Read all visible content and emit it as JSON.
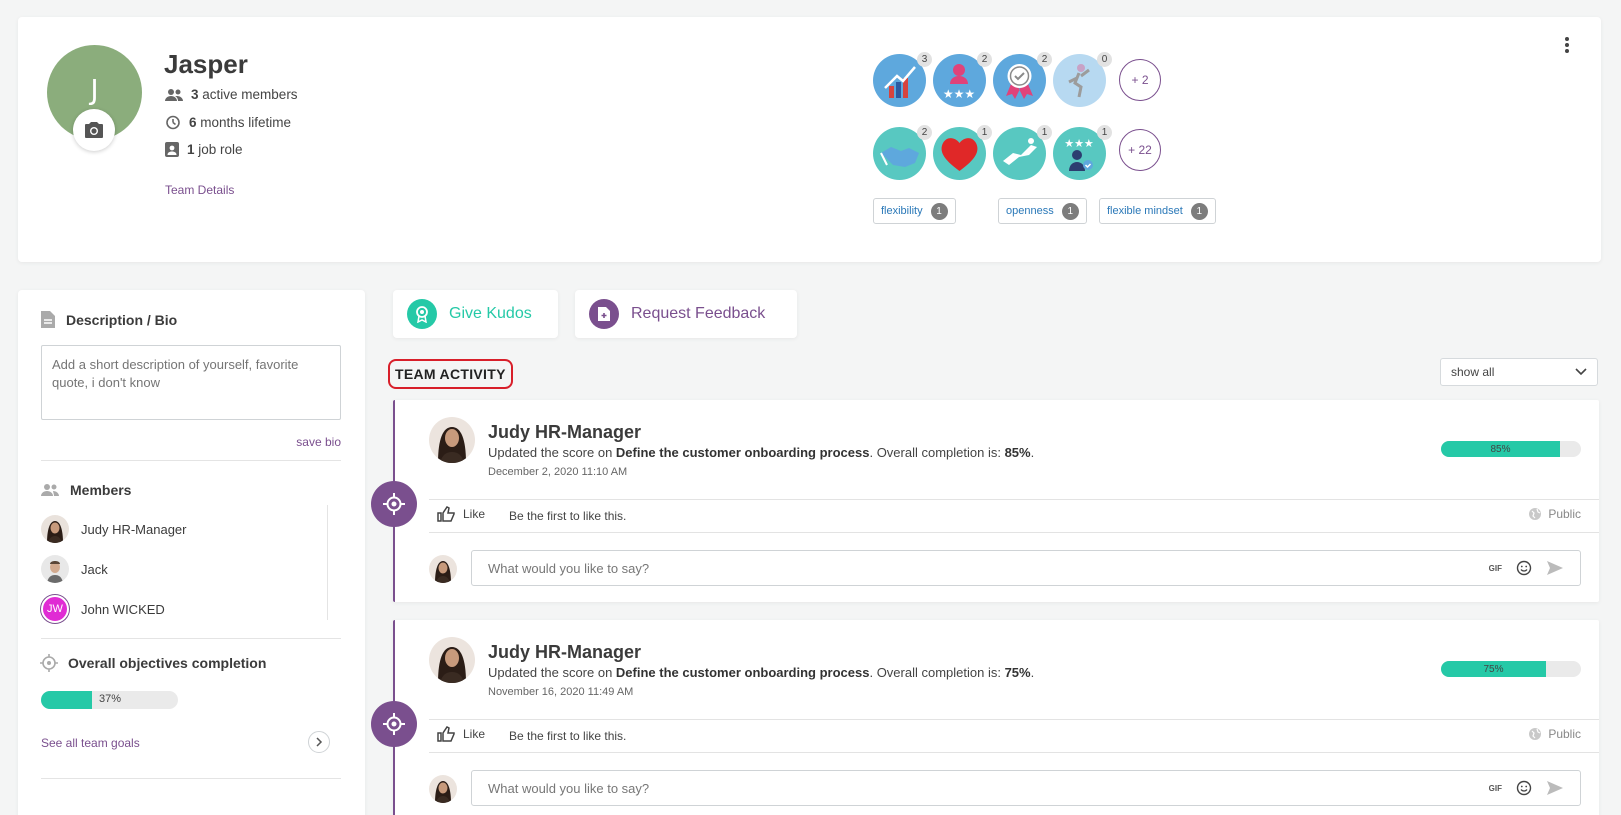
{
  "team": {
    "initial": "J",
    "name": "Jasper",
    "stats": [
      {
        "value": "3",
        "label": "active members"
      },
      {
        "value": "6",
        "label": "months lifetime"
      },
      {
        "value": "1",
        "label": "job role"
      }
    ],
    "details_link": "Team Details"
  },
  "badges": {
    "row1": [
      {
        "icon": "growth-chart-badge",
        "count": "3",
        "color": "#5ea8dd"
      },
      {
        "icon": "star-person-badge",
        "count": "2",
        "color": "#5ea8dd"
      },
      {
        "icon": "award-ribbon-badge",
        "count": "2",
        "color": "#5ea8dd"
      },
      {
        "icon": "dance-badge",
        "count": "0",
        "color": "#b7d9f1"
      }
    ],
    "row1_more": "+ 2",
    "row2": [
      {
        "icon": "handshake-badge",
        "count": "2",
        "color": "#58c8c1"
      },
      {
        "icon": "heart-hands-badge",
        "count": "1",
        "color": "#58c8c1"
      },
      {
        "icon": "leap-badge",
        "count": "1",
        "color": "#58c8c1"
      },
      {
        "icon": "star-person-check-badge",
        "count": "1",
        "color": "#58c8c1"
      }
    ],
    "row2_more": "+ 22"
  },
  "tags": [
    {
      "label": "flexibility",
      "count": "1"
    },
    {
      "label": "openness",
      "count": "1"
    },
    {
      "label": "flexible mindset",
      "count": "1"
    }
  ],
  "sidebar": {
    "bio_title": "Description / Bio",
    "bio_placeholder": "Add a short description of yourself, favorite quote, i don't know",
    "save_bio": "save bio",
    "members_title": "Members",
    "members": [
      {
        "name": "Judy HR-Manager"
      },
      {
        "name": "Jack"
      },
      {
        "name": "John WICKED",
        "initials": "JW"
      }
    ],
    "objectives_title": "Overall objectives completion",
    "objectives_progress": 37,
    "objectives_label": "37%",
    "see_goals": "See all team goals"
  },
  "actions": {
    "kudos": "Give Kudos",
    "feedback": "Request Feedback"
  },
  "activity": {
    "title": "TEAM ACTIVITY",
    "filter": "show all",
    "items": [
      {
        "author": "Judy HR-Manager",
        "msg_prefix": "Updated the score on ",
        "msg_target": "Define the customer onboarding process",
        "msg_mid": ". Overall completion is: ",
        "msg_value": "85%",
        "msg_end": ".",
        "time": "December 2, 2020 11:10 AM",
        "progress": 85,
        "progress_label": "85%",
        "like": "Like",
        "first_like": "Be the first to like this.",
        "visibility": "Public",
        "comment_placeholder": "What would you like to say?",
        "gif": "GIF"
      },
      {
        "author": "Judy HR-Manager",
        "msg_prefix": "Updated the score on ",
        "msg_target": "Define the customer onboarding process",
        "msg_mid": ". Overall completion is: ",
        "msg_value": "75%",
        "msg_end": ".",
        "time": "November 16, 2020 11:49 AM",
        "progress": 75,
        "progress_label": "75%",
        "like": "Like",
        "first_like": "Be the first to like this.",
        "visibility": "Public",
        "comment_placeholder": "What would you like to say?",
        "gif": "GIF"
      }
    ]
  },
  "colors": {
    "accent": "#7a4f8e",
    "progress": "#25c9a7",
    "kudos": "#25c9a7"
  }
}
